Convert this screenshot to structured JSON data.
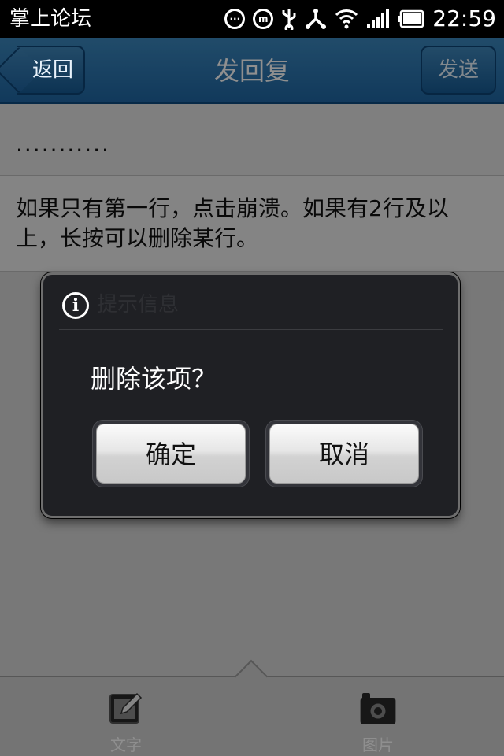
{
  "status_bar": {
    "app_name": "掌上论坛",
    "time": "22:59",
    "icons": [
      "more-icon",
      "m-notification-icon",
      "usb-icon",
      "debug-icon",
      "wifi-icon",
      "signal-icon",
      "battery-icon"
    ],
    "m_badge": "m"
  },
  "nav_bar": {
    "back_label": "返回",
    "title": "发回复",
    "send_label": "发送"
  },
  "content": {
    "rows": [
      {
        "text": "..........."
      },
      {
        "text": "如果只有第一行，点击崩溃。如果有2行及以上，长按可以删除某行。"
      }
    ]
  },
  "dialog": {
    "icon": "info-icon",
    "icon_glyph": "i",
    "title": "提示信息",
    "message": "删除该项？",
    "ok_label": "确定",
    "cancel_label": "取消"
  },
  "toolbar": {
    "text_label": "文字",
    "image_label": "图片",
    "text_icon": "edit-icon",
    "image_icon": "camera-icon"
  },
  "colors": {
    "nav_blue": "#2a73ad",
    "dialog_bg": "#1f2024",
    "status_bg": "#000000"
  }
}
